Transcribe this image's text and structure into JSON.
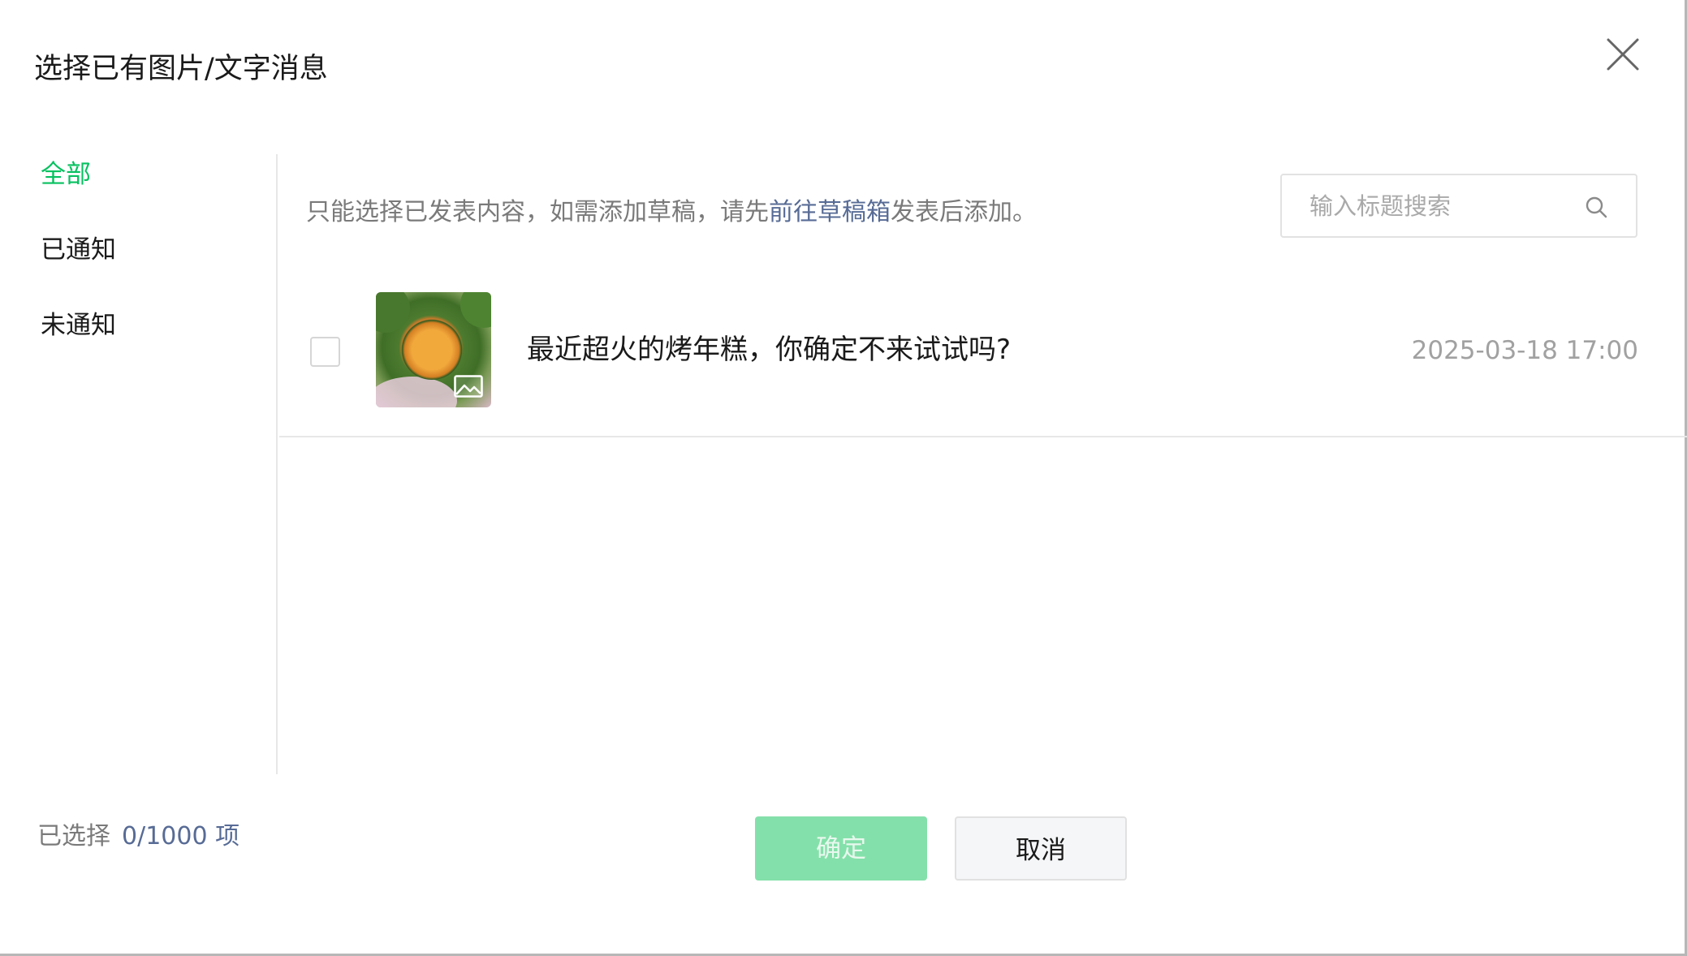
{
  "dialog": {
    "title": "选择已有图片/文字消息"
  },
  "sidebar": {
    "items": [
      {
        "label": "全部",
        "active": true
      },
      {
        "label": "已通知",
        "active": false
      },
      {
        "label": "未通知",
        "active": false
      }
    ]
  },
  "notice": {
    "before": "只能选择已发表内容，如需添加草稿，请先",
    "link": "前往草稿箱",
    "after": "发表后添加。"
  },
  "search": {
    "placeholder": "输入标题搜索",
    "value": ""
  },
  "list": {
    "items": [
      {
        "title": "最近超火的烤年糕，你确定不来试试吗?",
        "time": "2025-03-18 17:00",
        "checked": false
      }
    ]
  },
  "footer": {
    "selected_label": "已选择",
    "selected_count": "0/1000 项",
    "confirm_label": "确定",
    "cancel_label": "取消"
  },
  "colors": {
    "accent": "#07c160",
    "link": "#576b95",
    "confirm_disabled": "#84e0aa"
  },
  "icons": {
    "close": "close-icon",
    "search": "search-icon",
    "image_badge": "image-icon"
  }
}
